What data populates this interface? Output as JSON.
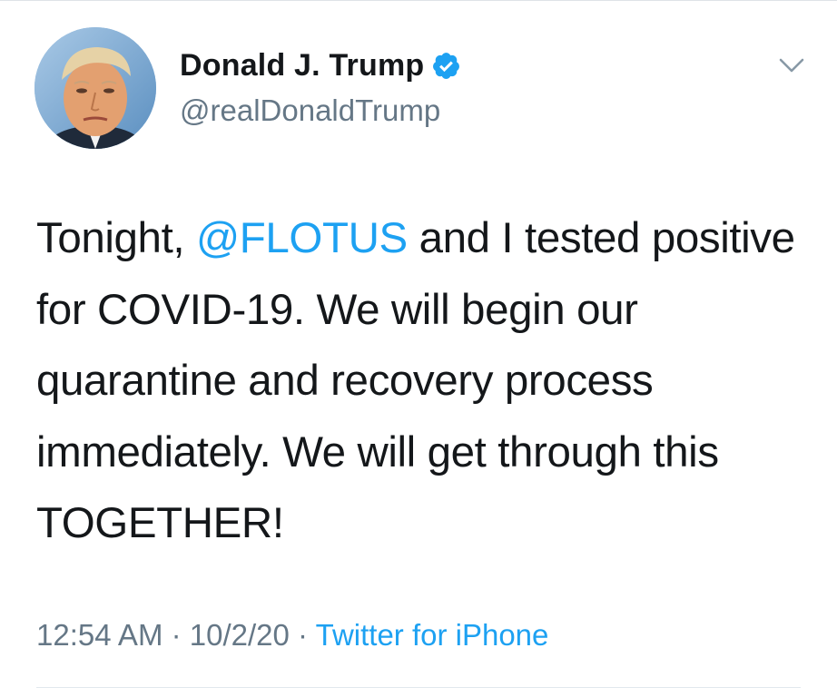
{
  "tweet": {
    "author": {
      "display_name": "Donald J. Trump",
      "handle": "@realDonaldTrump",
      "verified": true,
      "verified_icon": "verified-badge-icon",
      "avatar": "profile-photo"
    },
    "text": {
      "before_mention": "Tonight, ",
      "mention": "@FLOTUS",
      "after_mention": " and I tested positive for COVID-19. We will begin our quarantine and recovery process immediately. We will get through this TOGETHER!"
    },
    "meta": {
      "time": "12:54 AM",
      "separator_1": " · ",
      "date": "10/2/20",
      "separator_2": " · ",
      "source": "Twitter for iPhone"
    },
    "menu_icon": "chevron-down-icon"
  },
  "colors": {
    "text_primary": "#14171a",
    "text_secondary": "#657786",
    "accent": "#1da1f2",
    "divider": "#e1e8ed"
  }
}
